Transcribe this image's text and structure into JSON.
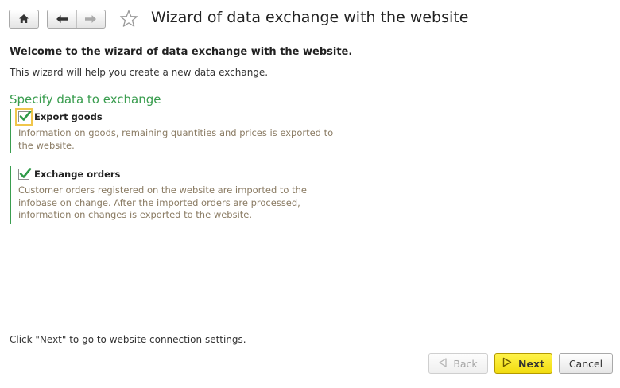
{
  "header": {
    "title": "Wizard of data exchange with the website",
    "icons": {
      "home": "home-icon",
      "back": "arrow-left-icon",
      "forward": "arrow-right-icon",
      "favorite": "star-icon"
    }
  },
  "main": {
    "welcome": "Welcome to the wizard of data exchange with the website.",
    "intro": "This wizard will help you create a new data exchange.",
    "section_title": "Specify data to exchange",
    "options": [
      {
        "label": "Export goods",
        "checked": true,
        "description": "Information on goods, remaining quantities and prices is exported to\nthe website."
      },
      {
        "label": "Exchange orders",
        "checked": true,
        "description": "Customer orders registered on the website are imported to the\ninfobase on change. After the imported orders are processed,\ninformation on changes is exported to the website."
      }
    ],
    "footer_note": "Click \"Next\" to go to website connection settings."
  },
  "buttons": {
    "back": "Back",
    "next": "Next",
    "cancel": "Cancel"
  },
  "colors": {
    "accent_green": "#3a9d4f",
    "description_text": "#8a7b63",
    "next_button": "#f7e52a",
    "focus_outline": "#f0c64b"
  }
}
